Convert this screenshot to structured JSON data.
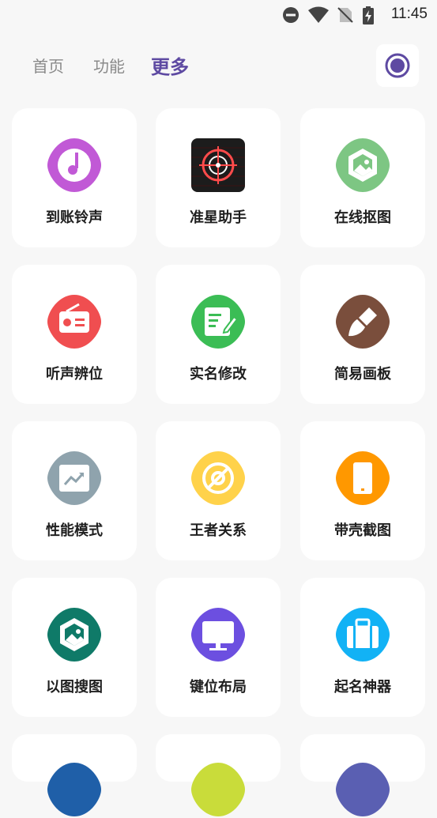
{
  "status_bar": {
    "time": "11:45"
  },
  "tabs": [
    {
      "label": "首页",
      "active": false
    },
    {
      "label": "功能",
      "active": false
    },
    {
      "label": "更多",
      "active": true
    }
  ],
  "colors": {
    "accent": "#5e4aa2"
  },
  "tools": [
    {
      "label": "到账铃声",
      "icon": "music-note-icon",
      "color": "#c159d6"
    },
    {
      "label": "准星助手",
      "icon": "crosshair-icon",
      "color": "#1c1c1c"
    },
    {
      "label": "在线抠图",
      "icon": "image-icon",
      "color": "#7dc683"
    },
    {
      "label": "听声辨位",
      "icon": "radio-icon",
      "color": "#f04e50"
    },
    {
      "label": "实名修改",
      "icon": "edit-note-icon",
      "color": "#3bbd55"
    },
    {
      "label": "简易画板",
      "icon": "brush-icon",
      "color": "#7a4e3c"
    },
    {
      "label": "性能模式",
      "icon": "trending-up-icon",
      "color": "#8fa3ad"
    },
    {
      "label": "王者关系",
      "icon": "target-icon",
      "color": "#ffd24a"
    },
    {
      "label": "带壳截图",
      "icon": "phone-frame-icon",
      "color": "#ff9800"
    },
    {
      "label": "以图搜图",
      "icon": "image-search-icon",
      "color": "#0f7a68"
    },
    {
      "label": "键位布局",
      "icon": "monitor-icon",
      "color": "#6c4fe0"
    },
    {
      "label": "起名神器",
      "icon": "briefcase-icon",
      "color": "#12b2f5"
    },
    {
      "label": "",
      "icon": "partial-icon",
      "color": "#1f5fa8"
    },
    {
      "label": "",
      "icon": "partial-icon",
      "color": "#c9dc3a"
    },
    {
      "label": "",
      "icon": "partial-icon",
      "color": "#5a5fb2"
    }
  ]
}
